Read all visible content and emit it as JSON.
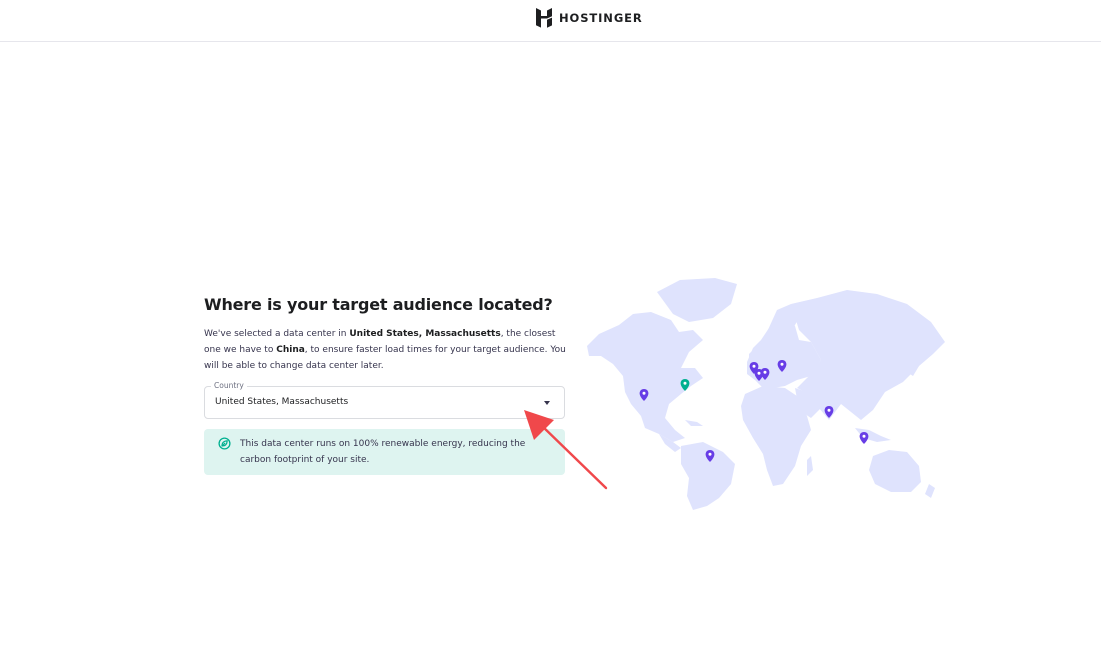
{
  "header": {
    "brand_name": "HOSTINGER",
    "logo_icon": "hostinger-logo-icon"
  },
  "main": {
    "title": "Where is your target audience located?",
    "description": {
      "part1": "We've selected a data center in ",
      "location": "United States, Massachusetts",
      "part2": ", the closest one we have to ",
      "audience": "China",
      "part3": ", to ensure faster load times for your target audience. You will be able to change data center later."
    },
    "country_select": {
      "label": "Country",
      "value": "United States, Massachusetts",
      "icon": "chevron-down-icon"
    },
    "notice": {
      "icon": "leaf-icon",
      "text": "This data center runs on 100% renewable energy, reducing the carbon footprint of your site."
    }
  },
  "map": {
    "land_color": "#dfe3fd",
    "pin_color": "#673de6",
    "selected_pin_color": "#00b090",
    "pins": [
      "us-west",
      "us-massachusetts",
      "brazil",
      "uk",
      "netherlands",
      "france",
      "germany",
      "lithuania",
      "india",
      "singapore"
    ],
    "selected_pin": "us-massachusetts"
  },
  "annotation": {
    "arrow_color": "#f0484b"
  }
}
